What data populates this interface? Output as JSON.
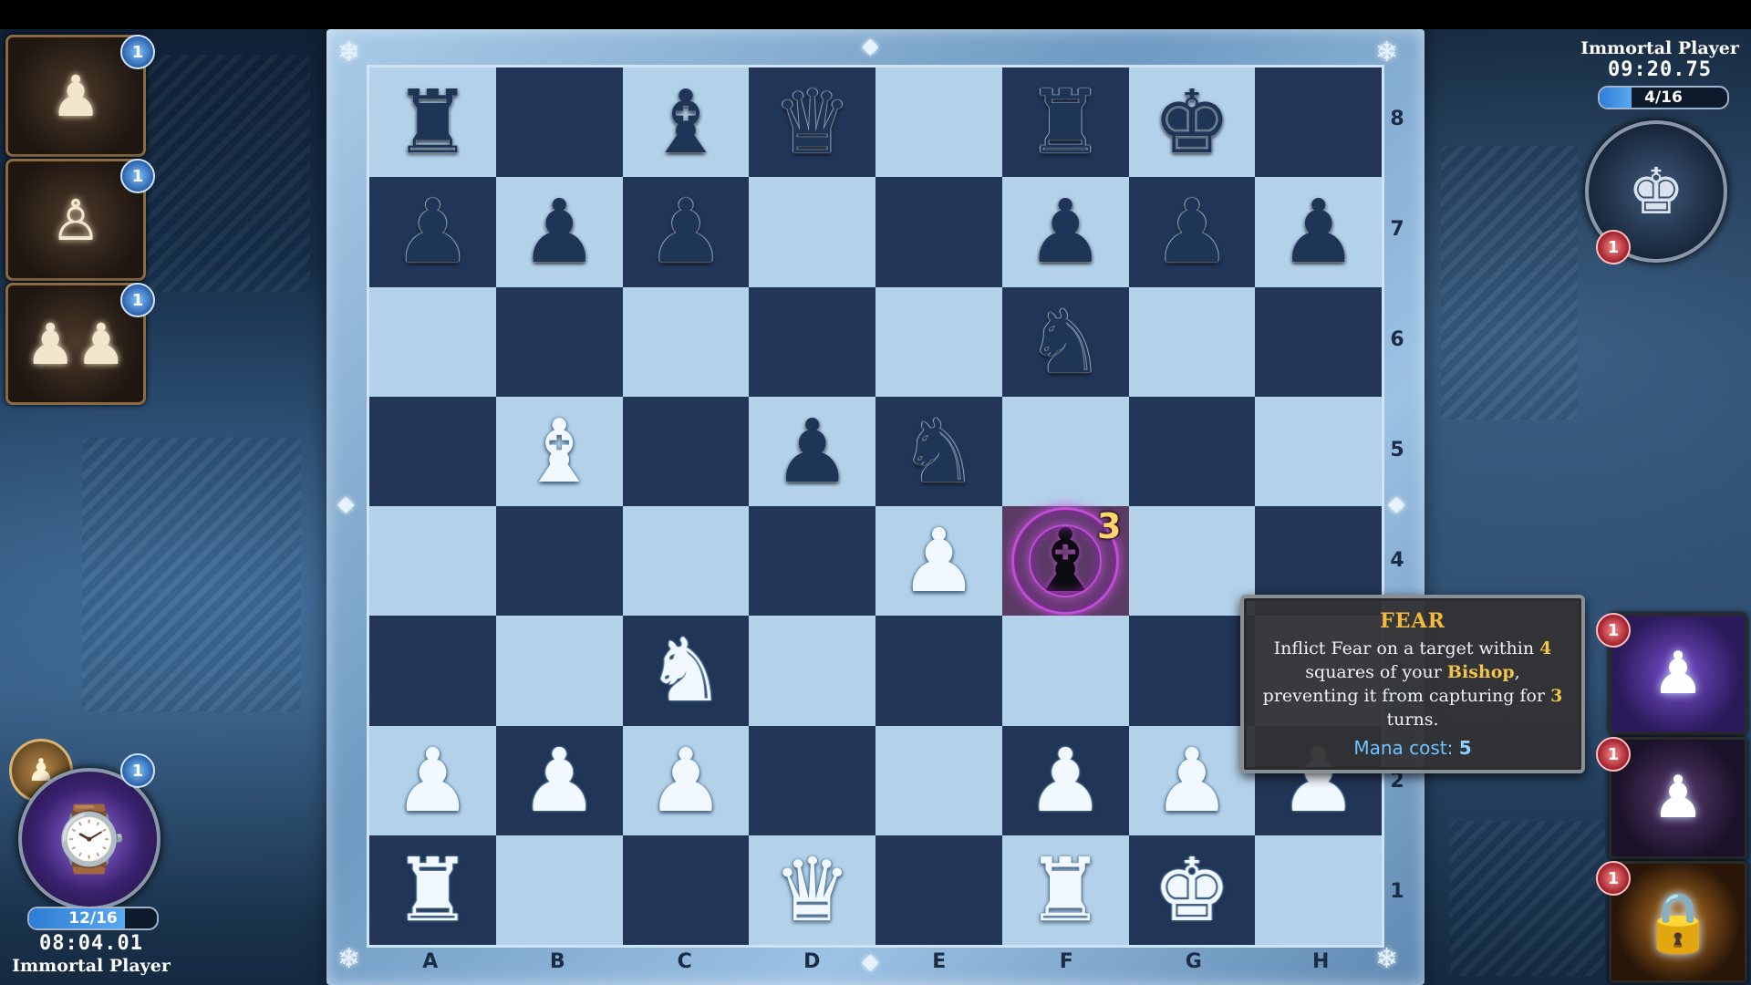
{
  "files": [
    "A",
    "B",
    "C",
    "D",
    "E",
    "F",
    "G",
    "H"
  ],
  "ranks": [
    "8",
    "7",
    "6",
    "5",
    "4",
    "3",
    "2",
    "1"
  ],
  "board": [
    [
      "br",
      "",
      "bb",
      "bq",
      "",
      "br",
      "bk",
      ""
    ],
    [
      "bp",
      "bp",
      "bp",
      "",
      "",
      "bp",
      "bp",
      "bp"
    ],
    [
      "",
      "",
      "",
      "",
      "",
      "bn",
      "",
      ""
    ],
    [
      "",
      "wb",
      "",
      "bp",
      "bn",
      "",
      "",
      ""
    ],
    [
      "",
      "",
      "",
      "",
      "wp",
      "fear",
      "",
      ""
    ],
    [
      "",
      "",
      "wn",
      "",
      "",
      "",
      "",
      ""
    ],
    [
      "wp",
      "wp",
      "wp",
      "",
      "",
      "wp",
      "wp",
      "wp"
    ],
    [
      "wr",
      "",
      "",
      "wq",
      "",
      "wr",
      "wk",
      ""
    ]
  ],
  "feared_square": {
    "piece_glyph": "♝",
    "turns_left": "3"
  },
  "player": {
    "name": "Immortal Player",
    "timer": "08:04.01",
    "mana": "12/16",
    "mana_fraction": 0.75,
    "ability_icons": [
      "pawn-comet-icon",
      "pawn-runes-icon",
      "twin-pawns-icon"
    ],
    "ability_orbs": [
      "1",
      "1",
      "1",
      "1"
    ]
  },
  "opponent": {
    "name": "Immortal Player",
    "timer": "09:20.75",
    "mana": "4/16",
    "mana_fraction": 0.25,
    "card_icons": [
      "pawn-swap-icon",
      "dark-pawn-sigil-icon",
      "chained-lock-icon"
    ],
    "orbs": [
      "1",
      "1",
      "1",
      "1"
    ]
  },
  "tooltip": {
    "title": "FEAR",
    "text_1": "Inflict Fear on a target within ",
    "range": "4",
    "text_2": " squares of your ",
    "piece": "Bishop",
    "text_3": ", preventing it from capturing for ",
    "turns": "3",
    "text_4": " turns.",
    "mana_label": "Mana cost: ",
    "mana_value": "5"
  },
  "colors": {
    "light_square": "#b3d2ea",
    "dark_square": "#213556",
    "accent_gold": "#f3b93c",
    "mana_blue": "#2e7dd6",
    "fear_purple": "#c04ed6"
  }
}
